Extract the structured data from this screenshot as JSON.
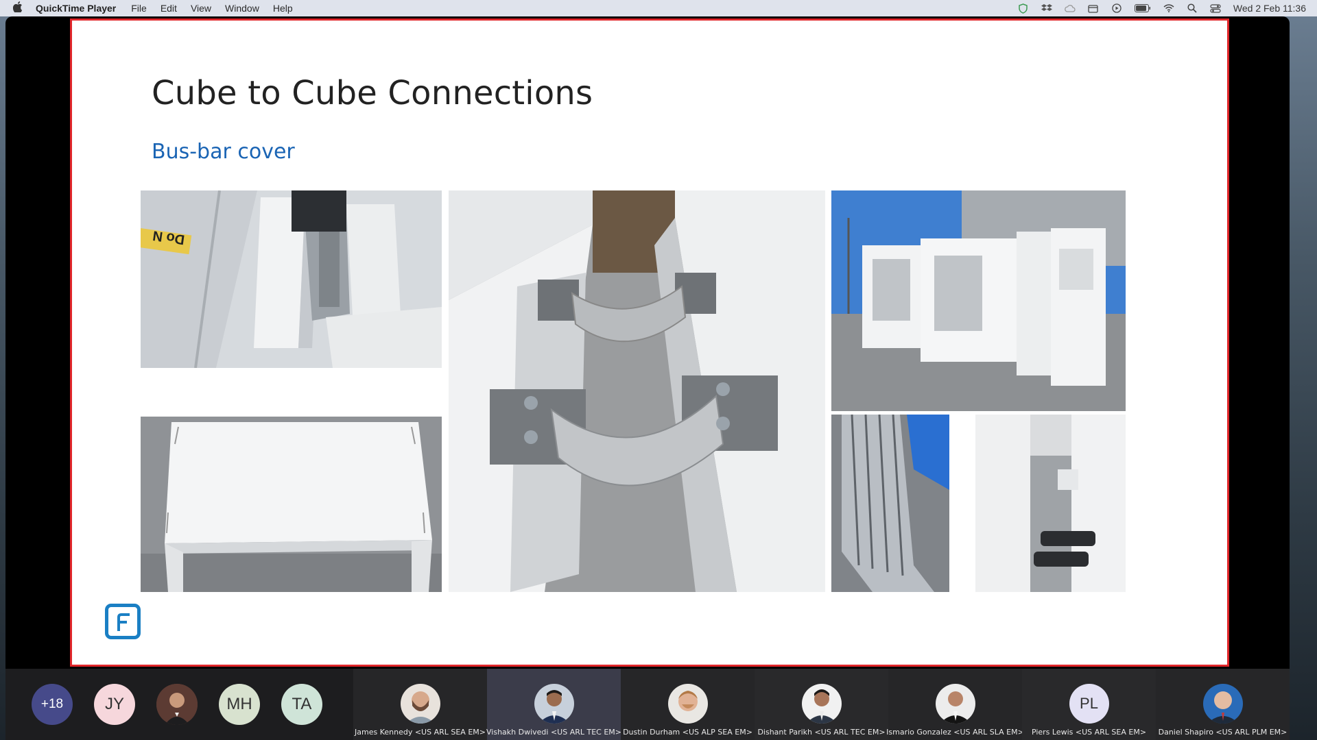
{
  "menubar": {
    "app_name": "QuickTime Player",
    "menus": [
      "File",
      "Edit",
      "View",
      "Window",
      "Help"
    ],
    "clock": "Wed 2 Feb  11:36"
  },
  "slide": {
    "title": "Cube to Cube Connections",
    "subtitle": "Bus-bar cover"
  },
  "participants": {
    "overflow_count": "+18",
    "initial_bubbles": [
      "JY",
      "MH",
      "TA"
    ],
    "tiles": [
      {
        "name": "James Kennedy <US ARL SEA EM>",
        "active": false
      },
      {
        "name": "Vishakh Dwivedi <US ARL TEC EM>",
        "active": true
      },
      {
        "name": "Dustin Durham <US ALP SEA EM>",
        "active": false
      },
      {
        "name": "Dishant Parikh <US ARL TEC EM>",
        "active": false
      },
      {
        "name": "Ismario Gonzalez <US ARL SLA EM>",
        "active": false
      },
      {
        "name": "Piers Lewis <US ARL SEA EM>",
        "active": false,
        "initials": "PL"
      },
      {
        "name": "Daniel Shapiro <US ARL PLM EM>",
        "active": false
      }
    ]
  },
  "colors": {
    "slide_border": "#e0262a",
    "subtitle": "#1a64b4",
    "logo": "#1a7fc4",
    "active_tile": "#3b3c4a"
  }
}
